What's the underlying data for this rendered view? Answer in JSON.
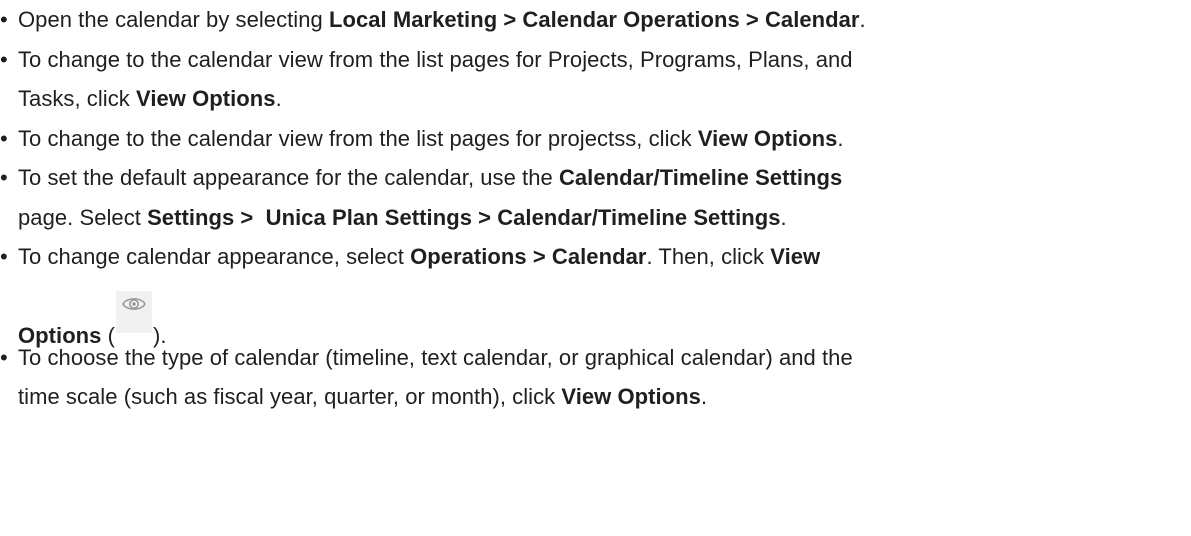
{
  "bullet_char": "•",
  "items": [
    {
      "lines": [
        [
          {
            "t": "Open the calendar by selecting ",
            "b": false
          },
          {
            "t": "Local Marketing > Calendar Operations > Calendar",
            "b": true
          },
          {
            "t": ".",
            "b": false
          }
        ]
      ]
    },
    {
      "lines": [
        [
          {
            "t": "To change to the calendar view from the list pages for Projects, Programs, Plans, and",
            "b": false
          }
        ],
        [
          {
            "t": "Tasks, click ",
            "b": false
          },
          {
            "t": "View Options",
            "b": true
          },
          {
            "t": ".",
            "b": false
          }
        ]
      ]
    },
    {
      "lines": [
        [
          {
            "t": "To change to the calendar view from the list pages for projectss, click ",
            "b": false
          },
          {
            "t": "View Options",
            "b": true
          },
          {
            "t": ".",
            "b": false
          }
        ]
      ]
    },
    {
      "lines": [
        [
          {
            "t": "To set the default appearance for the calendar, use the ",
            "b": false
          },
          {
            "t": "Calendar/Timeline Settings",
            "b": true
          }
        ],
        [
          {
            "t": "page. Select ",
            "b": false
          },
          {
            "t": "Settings >  Unica Plan Settings > Calendar/Timeline Settings",
            "b": true
          },
          {
            "t": ".",
            "b": false
          }
        ]
      ]
    },
    {
      "lines": [
        [
          {
            "t": "To change calendar appearance, select ",
            "b": false
          },
          {
            "t": "Operations > Calendar",
            "b": true
          },
          {
            "t": ". Then, click ",
            "b": false
          },
          {
            "t": "View",
            "b": true
          }
        ],
        [
          {
            "t": "Options",
            "b": true
          },
          {
            "t": " (",
            "b": false
          },
          {
            "icon": "eye-icon"
          },
          {
            "t": ").",
            "b": false
          }
        ]
      ]
    },
    {
      "lines": [
        [
          {
            "t": "To choose the type of calendar (timeline, text calendar, or graphical calendar) and the",
            "b": false
          }
        ],
        [
          {
            "t": "time scale (such as fiscal year, quarter, or month), click ",
            "b": false
          },
          {
            "t": "View Options",
            "b": true
          },
          {
            "t": ".",
            "b": false
          }
        ]
      ]
    }
  ]
}
